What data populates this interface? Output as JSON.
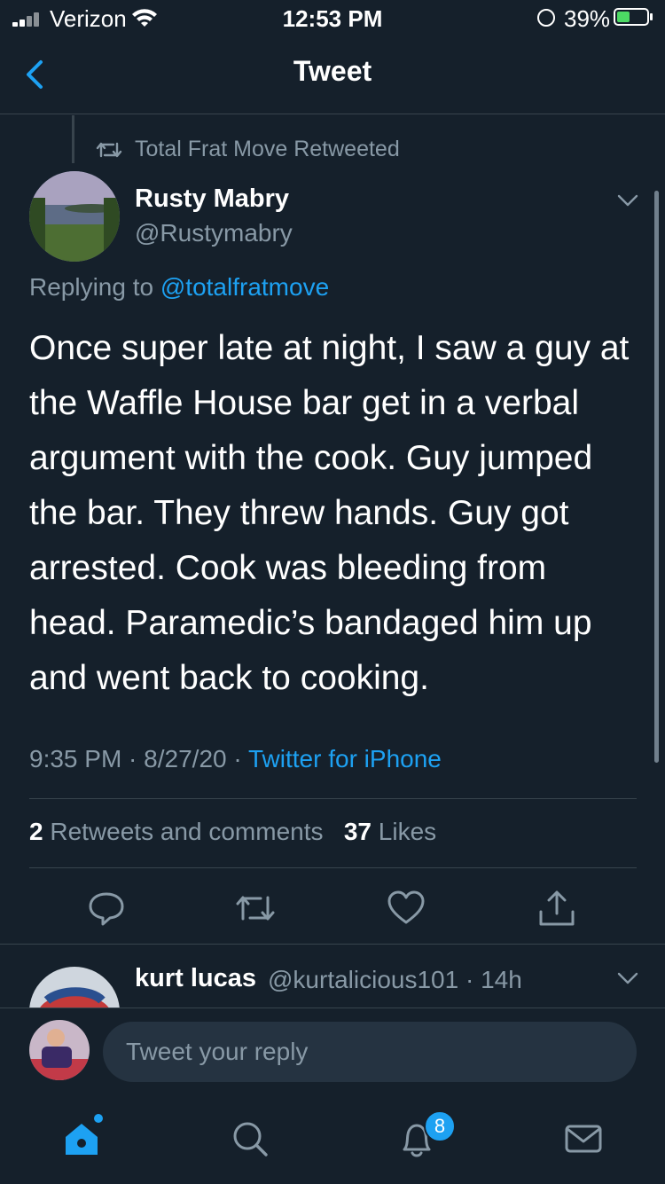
{
  "status_bar": {
    "carrier": "Verizon",
    "time": "12:53 PM",
    "battery": "39%",
    "battery_level": 0.39
  },
  "nav": {
    "title": "Tweet",
    "back_icon": "chevron-left-icon"
  },
  "retweet_context": "Total Frat Move Retweeted",
  "tweet": {
    "author_name": "Rusty Mabry",
    "author_handle": "@Rustymabry",
    "replying_prefix": "Replying to",
    "replying_handle": "@totalfratmove",
    "text": "Once super late at night, I saw a guy at the Waffle House bar get in a verbal argument with the cook. Guy jumped the bar. They threw hands. Guy got arrested. Cook was bleeding from head. Paramedic’s bandaged him up and went back to cooking.",
    "time": "9:35 PM",
    "date": "8/27/20",
    "source": "Twitter for iPhone",
    "retweets_count": "2",
    "retweets_label": "Retweets and comments",
    "likes_count": "37",
    "likes_label": "Likes"
  },
  "reply": {
    "author_name": "kurt lucas",
    "author_handle": "@kurtalicious101",
    "age": "14h"
  },
  "composer": {
    "placeholder": "Tweet your reply"
  },
  "tab_bar": {
    "notifications_badge": "8"
  },
  "colors": {
    "background": "#15202b",
    "accent": "#1da1f2",
    "muted": "#8899a6",
    "border": "#38444d"
  }
}
